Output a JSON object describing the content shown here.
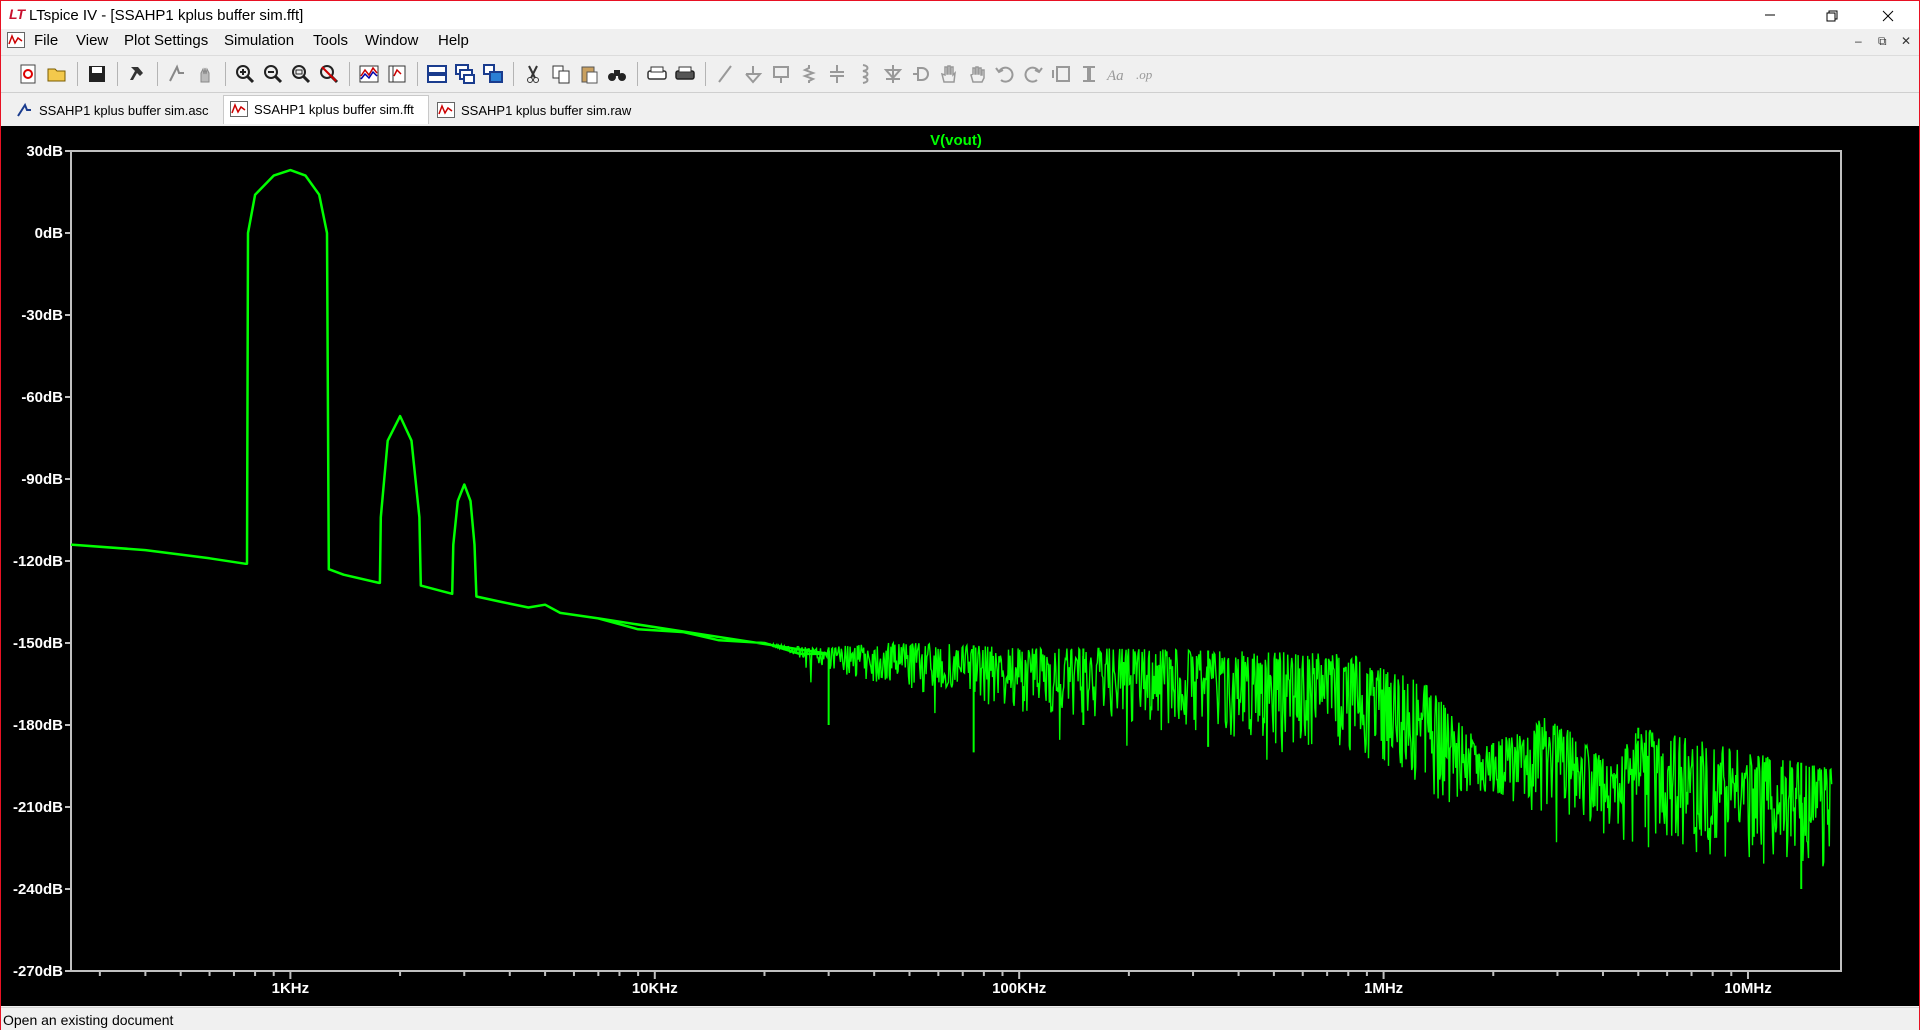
{
  "window": {
    "title": "LTspice IV - [SSAHP1 kplus buffer sim.fft]",
    "logo_text": "LT",
    "minimize_glyph": "—",
    "close_glyph": "✕"
  },
  "menu": {
    "items": [
      "File",
      "View",
      "Plot Settings",
      "Simulation",
      "Tools",
      "Window",
      "Help"
    ],
    "mdi_minimize": "–",
    "mdi_restore": "⧉",
    "mdi_close": "✕"
  },
  "toolbar": {
    "tools": [
      "new-schematic-icon",
      "open-icon",
      "save-icon",
      "control-panel-icon",
      "run-icon",
      "halt-icon",
      "zoom-in-icon",
      "zoom-out-icon",
      "zoom-fit-icon",
      "zoom-cancel-icon",
      "autorange-icon",
      "plot-setup-icon",
      "tile-horizontal-icon",
      "cascade-icon",
      "tile-vertical-icon",
      "cut-icon",
      "copy-icon",
      "paste-icon",
      "find-icon",
      "print-preview-icon",
      "print-icon",
      "wire-icon",
      "ground-icon",
      "label-icon",
      "resistor-icon",
      "capacitor-icon",
      "inductor-icon",
      "diode-icon",
      "component-icon",
      "move-icon",
      "drag-icon",
      "undo-icon",
      "redo-icon",
      "rotate-icon",
      "mirror-icon",
      "text-icon",
      "spice-directive-icon"
    ]
  },
  "tabs": [
    {
      "label": "SSAHP1 kplus buffer sim.asc",
      "icon": "schematic-icon",
      "active": false
    },
    {
      "label": "SSAHP1 kplus buffer sim.fft",
      "icon": "waveform-icon",
      "active": true
    },
    {
      "label": "SSAHP1 kplus buffer sim.raw",
      "icon": "waveform-icon",
      "active": false
    }
  ],
  "chart_data": {
    "type": "line",
    "title": "V(vout)",
    "xlabel": "",
    "ylabel": "",
    "xscale": "log",
    "x_ticks": [
      "1KHz",
      "10KHz",
      "100KHz",
      "1MHz",
      "10MHz"
    ],
    "y_ticks": [
      "30dB",
      "0dB",
      "-30dB",
      "-60dB",
      "-90dB",
      "-120dB",
      "-150dB",
      "-180dB",
      "-210dB",
      "-240dB",
      "-270dB"
    ],
    "xlim": [
      250,
      18000000
    ],
    "ylim": [
      -270,
      30
    ],
    "grid": false,
    "colors": {
      "trace": "#00ff00",
      "frame": "#c0c0c0",
      "background": "#000000",
      "labels": "#ffffff"
    },
    "series": [
      {
        "name": "V(vout)",
        "points": [
          [
            250,
            -114
          ],
          [
            400,
            -116
          ],
          [
            600,
            -119
          ],
          [
            750,
            -121
          ],
          [
            760,
            -121
          ],
          [
            765,
            0
          ],
          [
            800,
            14
          ],
          [
            900,
            21
          ],
          [
            1000,
            23
          ],
          [
            1100,
            21
          ],
          [
            1200,
            14
          ],
          [
            1260,
            0
          ],
          [
            1275,
            -123
          ],
          [
            1400,
            -125
          ],
          [
            1750,
            -128
          ],
          [
            1760,
            -128
          ],
          [
            1770,
            -104
          ],
          [
            1850,
            -76
          ],
          [
            2000,
            -67
          ],
          [
            2150,
            -76
          ],
          [
            2260,
            -104
          ],
          [
            2280,
            -129
          ],
          [
            2600,
            -131
          ],
          [
            2780,
            -132
          ],
          [
            2800,
            -114
          ],
          [
            2880,
            -98
          ],
          [
            3000,
            -92
          ],
          [
            3120,
            -98
          ],
          [
            3200,
            -114
          ],
          [
            3240,
            -133
          ],
          [
            3800,
            -135
          ],
          [
            4500,
            -137
          ],
          [
            5000,
            -136
          ],
          [
            5500,
            -139
          ],
          [
            7000,
            -141
          ],
          [
            9000,
            -145
          ],
          [
            12000,
            -146
          ],
          [
            15000,
            -149
          ],
          [
            20000,
            -150
          ],
          [
            25000,
            -154
          ],
          [
            30000,
            -154
          ],
          [
            32000,
            -180
          ],
          [
            34000,
            -155
          ],
          [
            45000,
            -155
          ],
          [
            50000,
            -175
          ],
          [
            55000,
            -153
          ],
          [
            60000,
            -172
          ],
          [
            70000,
            -156
          ],
          [
            75000,
            -190
          ],
          [
            80000,
            -157
          ],
          [
            100000,
            -158
          ],
          [
            110000,
            -178
          ],
          [
            120000,
            -158
          ],
          [
            140000,
            -175
          ],
          [
            150000,
            -158
          ],
          [
            170000,
            -182
          ],
          [
            200000,
            -158
          ],
          [
            230000,
            -183
          ],
          [
            250000,
            -160
          ],
          [
            300000,
            -185
          ],
          [
            350000,
            -161
          ],
          [
            420000,
            -190
          ],
          [
            500000,
            -160
          ],
          [
            600000,
            -188
          ],
          [
            700000,
            -163
          ],
          [
            800000,
            -195
          ],
          [
            900000,
            -165
          ],
          [
            1000000,
            -168
          ],
          [
            1200000,
            -182
          ],
          [
            1500000,
            -200
          ],
          [
            1800000,
            -190
          ],
          [
            2000000,
            -192
          ],
          [
            2200000,
            -186
          ],
          [
            2500000,
            -180
          ],
          [
            3000000,
            -178
          ],
          [
            3500000,
            -188
          ],
          [
            4000000,
            -195
          ],
          [
            4500000,
            -200
          ],
          [
            5000000,
            -185
          ],
          [
            5500000,
            -182
          ],
          [
            6000000,
            -190
          ],
          [
            7000,
            -141
          ]
        ],
        "noise_envelope": [
          [
            20000,
            -150,
            -150
          ],
          [
            28000,
            -152,
            -158
          ],
          [
            40000,
            -150,
            -165
          ],
          [
            60000,
            -150,
            -170
          ],
          [
            100000,
            -152,
            -175
          ],
          [
            200000,
            -152,
            -180
          ],
          [
            400000,
            -153,
            -185
          ],
          [
            800000,
            -154,
            -190
          ],
          [
            1000000,
            -157,
            -195
          ],
          [
            1300000,
            -165,
            -205
          ],
          [
            1600000,
            -178,
            -212
          ],
          [
            1900000,
            -188,
            -205
          ],
          [
            2200000,
            -184,
            -210
          ],
          [
            2800000,
            -177,
            -213
          ],
          [
            3500000,
            -185,
            -215
          ],
          [
            4200000,
            -195,
            -222
          ],
          [
            5000000,
            -181,
            -225
          ],
          [
            6000000,
            -183,
            -225
          ],
          [
            8000000,
            -187,
            -228
          ],
          [
            10000000,
            -190,
            -230
          ],
          [
            13000000,
            -193,
            -232
          ],
          [
            17000000,
            -196,
            -233
          ]
        ],
        "spikes": [
          [
            30000,
            -180
          ],
          [
            75000,
            -190
          ],
          [
            150000,
            -180
          ],
          [
            330000,
            -188
          ],
          [
            2000000,
            -200
          ],
          [
            5000000,
            -185
          ],
          [
            14000000,
            -240
          ]
        ]
      }
    ]
  },
  "status": {
    "text": "Open an existing document"
  }
}
